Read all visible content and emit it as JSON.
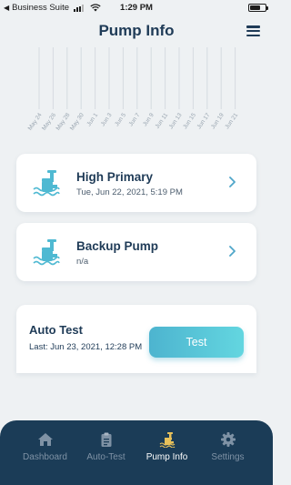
{
  "status_bar": {
    "back_arrow": "◀",
    "carrier": "Business Suite",
    "time": "1:29 PM"
  },
  "header": {
    "title": "Pump Info"
  },
  "chart_data": {
    "type": "bar",
    "categories": [
      "May 24",
      "May 26",
      "May 28",
      "May 30",
      "Jun 1",
      "Jun 3",
      "Jun 5",
      "Jun 7",
      "Jun 9",
      "Jun 11",
      "Jun 13",
      "Jun 15",
      "Jun 17",
      "Jun 19",
      "Jun 21"
    ],
    "values": [],
    "grid": true
  },
  "pumps": [
    {
      "name": "High Primary",
      "last_run": "Tue, Jun 22, 2021, 5:19 PM",
      "icon": "pump-icon"
    },
    {
      "name": "Backup Pump",
      "last_run": "n/a",
      "icon": "pump-icon"
    }
  ],
  "auto_test": {
    "title": "Auto Test",
    "last": "Last: Jun 23, 2021, 12:28 PM",
    "button_label": "Test"
  },
  "tab_bar": {
    "tabs": [
      {
        "label": "Dashboard",
        "icon": "home-icon",
        "active": false
      },
      {
        "label": "Auto-Test",
        "icon": "clipboard-icon",
        "active": false
      },
      {
        "label": "Pump Info",
        "icon": "pump-icon",
        "active": true
      },
      {
        "label": "Settings",
        "icon": "gear-icon",
        "active": false
      }
    ]
  },
  "colors": {
    "background": "#eef1f3",
    "navy": "#1f3b57",
    "tab_bar": "#1b3c57",
    "accent_teal": "#4fb9d2",
    "active_tab_icon": "#e8c15a",
    "inactive_tab": "#7f92a5"
  }
}
